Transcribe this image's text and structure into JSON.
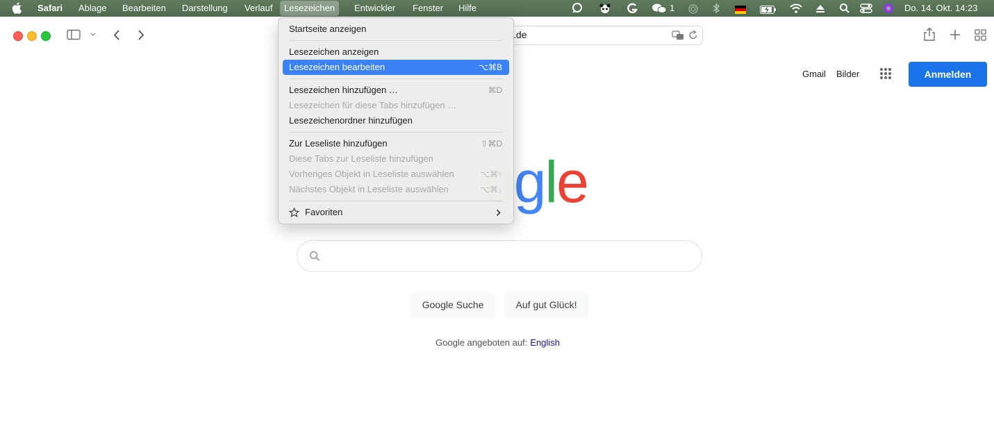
{
  "menubar": {
    "app": "Safari",
    "items": [
      "Ablage",
      "Bearbeiten",
      "Darstellung",
      "Verlauf",
      "Lesezeichen",
      "Entwickler",
      "Fenster",
      "Hilfe"
    ],
    "active": "Lesezeichen",
    "wechat_count": "1",
    "datetime": "Do. 14. Okt.  14:23"
  },
  "toolbar": {
    "address_text": ".de"
  },
  "google": {
    "gmail": "Gmail",
    "images": "Bilder",
    "signin": "Anmelden",
    "logo_visible": "gle",
    "search_button": "Google Suche",
    "lucky_button": "Auf gut Glück!",
    "offered_in": "Google angeboten auf:",
    "language_link": "English",
    "colors": {
      "blue": "#4285f4",
      "red": "#ea4335",
      "yellow": "#fbbc05",
      "green": "#34a853",
      "button": "#1a73e8"
    }
  },
  "bookmarks_menu": {
    "items": [
      {
        "label": "Startseite anzeigen",
        "shortcut": "",
        "enabled": true
      },
      {
        "label": "Lesezeichen anzeigen",
        "shortcut": "",
        "enabled": true
      },
      {
        "label": "Lesezeichen bearbeiten",
        "shortcut": "⌥⌘B",
        "enabled": true,
        "highlighted": true
      },
      {
        "label": "Lesezeichen hinzufügen …",
        "shortcut": "⌘D",
        "enabled": true
      },
      {
        "label": "Lesezeichen für diese Tabs hinzufügen …",
        "shortcut": "",
        "enabled": false
      },
      {
        "label": "Lesezeichenordner hinzufügen",
        "shortcut": "",
        "enabled": true
      },
      {
        "label": "Zur Leseliste hinzufügen",
        "shortcut": "⇧⌘D",
        "enabled": true
      },
      {
        "label": "Diese Tabs zur Leseliste hinzufügen",
        "shortcut": "",
        "enabled": false
      },
      {
        "label": "Vorheriges Objekt in Leseliste auswählen",
        "shortcut": "⌥⌘↑",
        "enabled": false
      },
      {
        "label": "Nächstes Objekt in Leseliste auswählen",
        "shortcut": "⌥⌘↓",
        "enabled": false
      },
      {
        "label": "Favoriten",
        "shortcut": "",
        "enabled": true,
        "submenu": true
      }
    ]
  }
}
